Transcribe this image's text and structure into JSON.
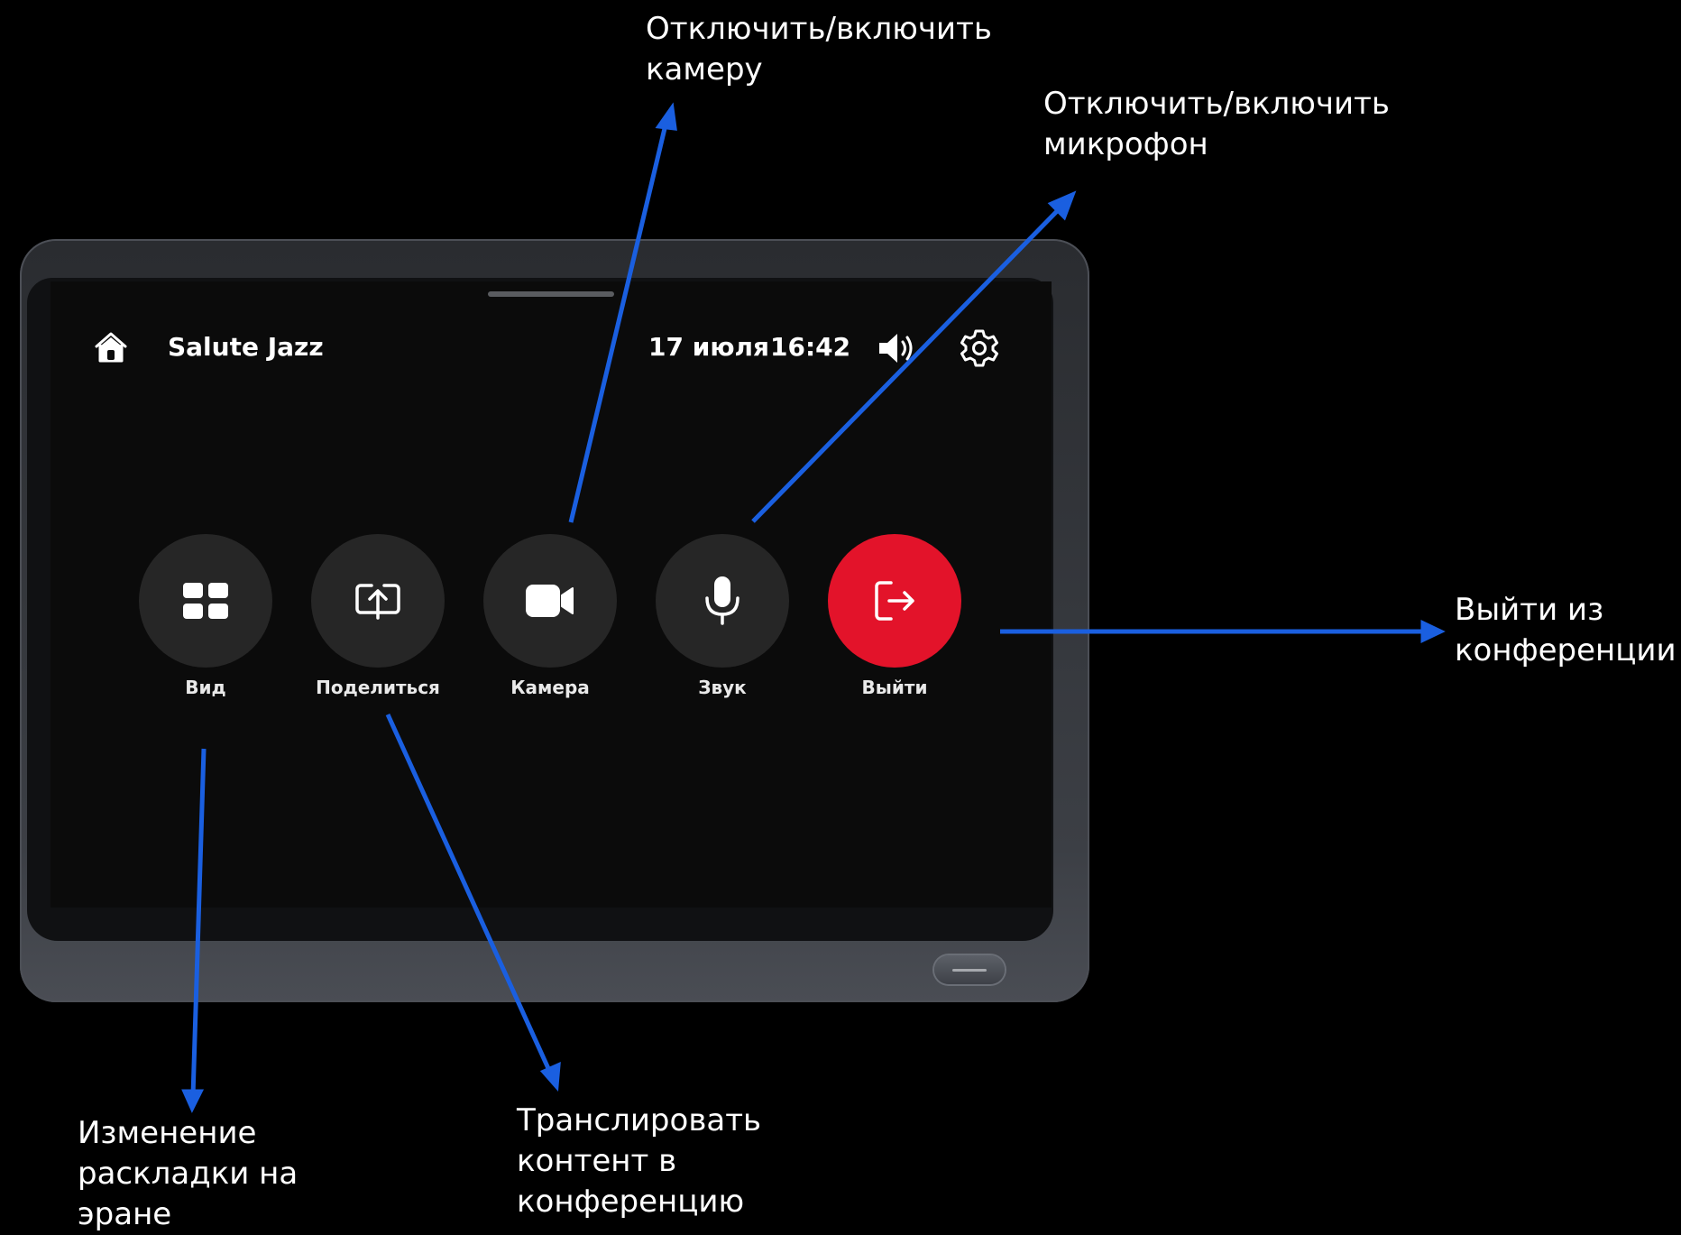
{
  "header": {
    "app_title": "Salute Jazz",
    "date": "17 июля",
    "time": "16:42",
    "icons": [
      "home-icon",
      "volume-icon",
      "gear-icon"
    ]
  },
  "controls": [
    {
      "label": "Вид",
      "icon": "grid-icon"
    },
    {
      "label": "Поделиться",
      "icon": "share-screen-icon"
    },
    {
      "label": "Камера",
      "icon": "camera-icon"
    },
    {
      "label": "Звук",
      "icon": "microphone-icon"
    },
    {
      "label": "Выйти",
      "icon": "exit-icon",
      "color": "#e3132a"
    }
  ],
  "annotations": {
    "camera": "Отключить/включить\nкамеру",
    "microphone": "Отключить/включить\nмикрофон",
    "exit": "Выйти из\nконференции",
    "layout": "Изменение\nраскладки на\nэране",
    "share": "Транслировать\nконтент в\nконференцию"
  },
  "colors": {
    "accent_red": "#e3132a",
    "arrow_blue": "#1a5fe0",
    "button_bg": "#262626"
  }
}
